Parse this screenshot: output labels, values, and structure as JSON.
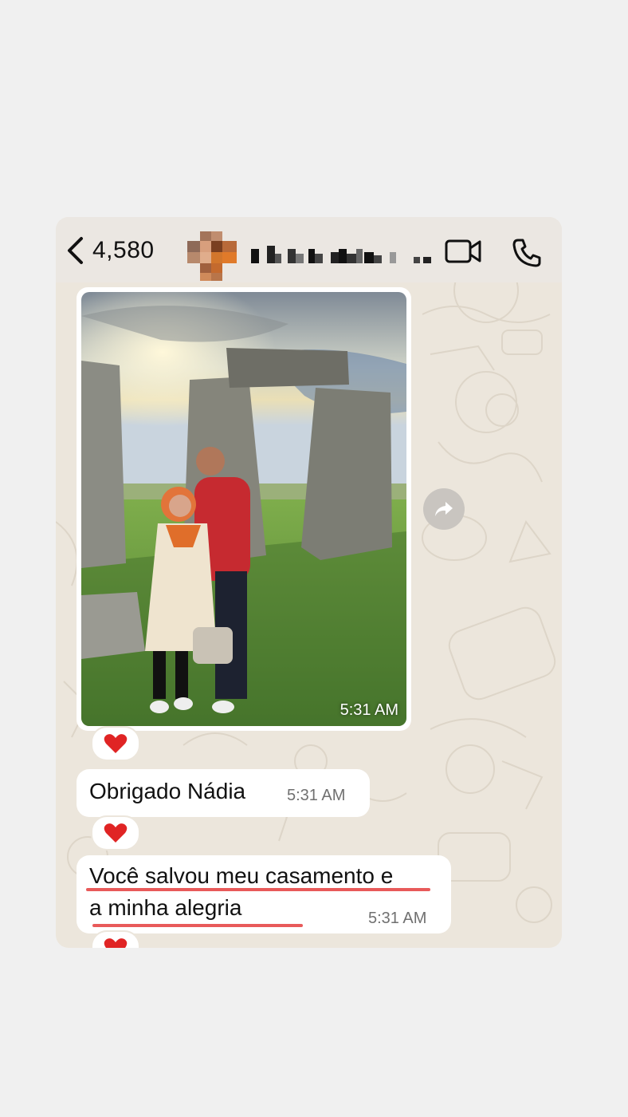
{
  "header": {
    "back_count": "4,580",
    "contact_name": ""
  },
  "messages": [
    {
      "type": "photo",
      "time": "5:31 AM",
      "reaction": "heart"
    },
    {
      "type": "text",
      "text": "Obrigado Nádia",
      "time": "5:31 AM",
      "reaction": "heart"
    },
    {
      "type": "text",
      "line1": "Você salvou meu casamento e",
      "line2": "a minha alegria",
      "time": "5:31 AM",
      "reaction": "heart"
    }
  ],
  "colors": {
    "chat_background": "#ece6dc",
    "header_background": "#ebe7e2",
    "bubble": "#ffffff",
    "underline": "#e85a5a",
    "heart": "#e02424"
  },
  "icons": [
    "back-chevron-icon",
    "video-call-icon",
    "phone-call-icon",
    "forward-icon",
    "heart-icon"
  ]
}
